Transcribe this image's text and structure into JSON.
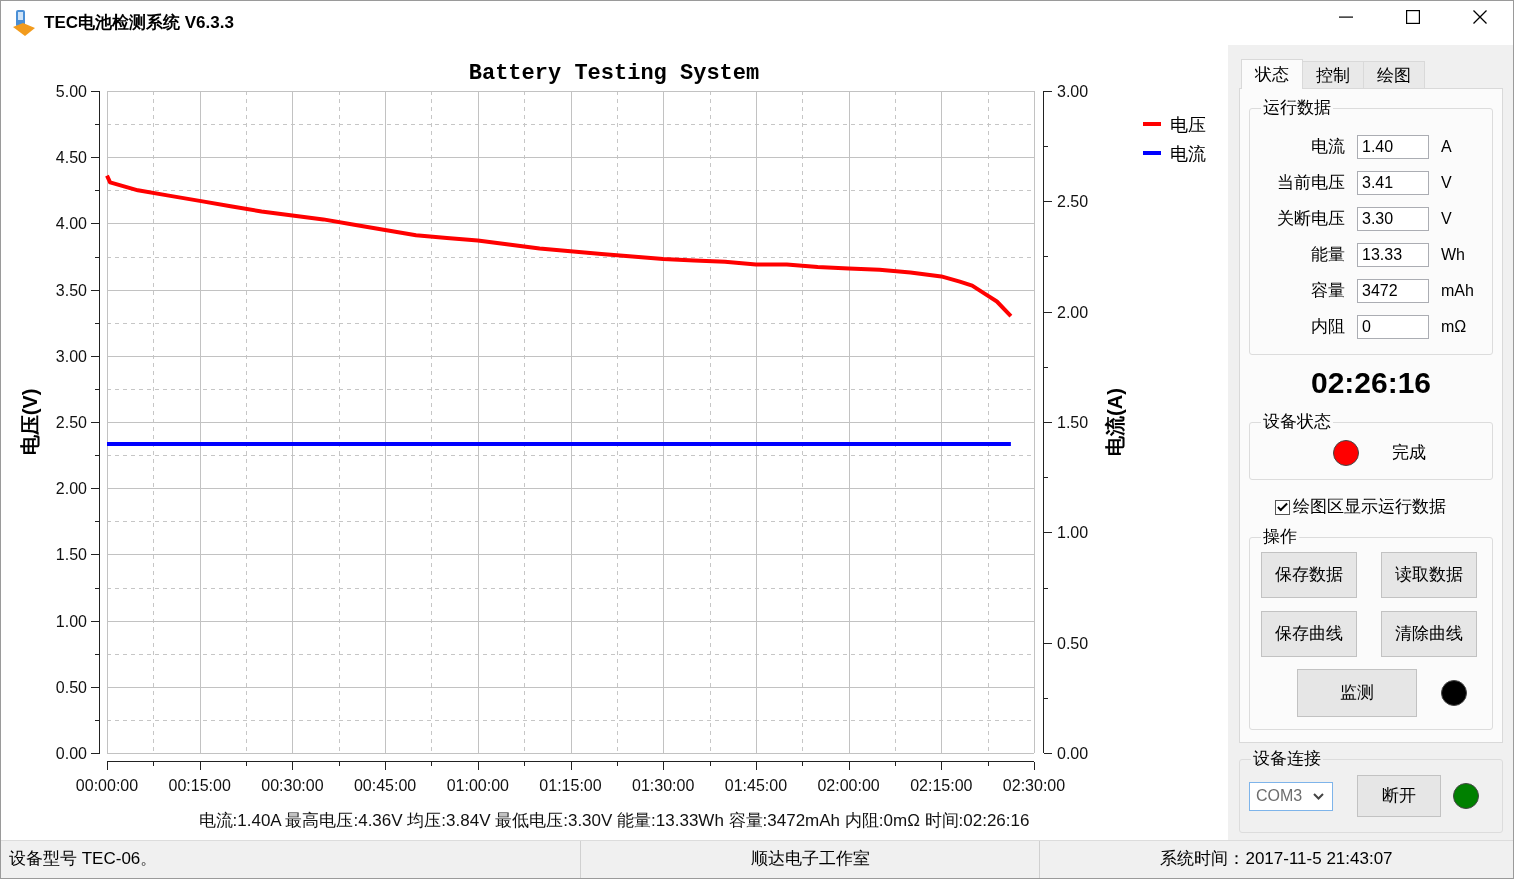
{
  "window": {
    "title": "TEC电池检测系统 V6.3.3"
  },
  "chart": {
    "chart_data": {
      "type": "line",
      "title": "Battery Testing System",
      "ylabel": "电压(V)",
      "y2label": "电流(A)",
      "grid": true,
      "legend": "right",
      "x": [
        0,
        0.5,
        5,
        10,
        15,
        20,
        25,
        30,
        35,
        40,
        45,
        50,
        55,
        60,
        65,
        70,
        75,
        80,
        85,
        90,
        95,
        100,
        105,
        110,
        115,
        120,
        125,
        130,
        135,
        138,
        140,
        142,
        144,
        146.27
      ],
      "xlim": [
        0,
        150
      ],
      "ylim": [
        0,
        5
      ],
      "y2lim": [
        0,
        3
      ],
      "xticks": [
        {
          "value": 0,
          "label": "00:00:00"
        },
        {
          "value": 15,
          "label": "00:15:00"
        },
        {
          "value": 30,
          "label": "00:30:00"
        },
        {
          "value": 45,
          "label": "00:45:00"
        },
        {
          "value": 60,
          "label": "01:00:00"
        },
        {
          "value": 75,
          "label": "01:15:00"
        },
        {
          "value": 90,
          "label": "01:30:00"
        },
        {
          "value": 105,
          "label": "01:45:00"
        },
        {
          "value": 120,
          "label": "02:00:00"
        },
        {
          "value": 135,
          "label": "02:15:00"
        },
        {
          "value": 150,
          "label": "02:30:00"
        }
      ],
      "yticks": [
        {
          "value": 0,
          "label": "0.00"
        },
        {
          "value": 0.5,
          "label": "0.50"
        },
        {
          "value": 1,
          "label": "1.00"
        },
        {
          "value": 1.5,
          "label": "1.50"
        },
        {
          "value": 2,
          "label": "2.00"
        },
        {
          "value": 2.5,
          "label": "2.50"
        },
        {
          "value": 3,
          "label": "3.00"
        },
        {
          "value": 3.5,
          "label": "3.50"
        },
        {
          "value": 4,
          "label": "4.00"
        },
        {
          "value": 4.5,
          "label": "4.50"
        },
        {
          "value": 5,
          "label": "5.00"
        }
      ],
      "y2ticks": [
        {
          "value": 0,
          "label": "0.00"
        },
        {
          "value": 0.5,
          "label": "0.50"
        },
        {
          "value": 1,
          "label": "1.00"
        },
        {
          "value": 1.5,
          "label": "1.50"
        },
        {
          "value": 2,
          "label": "2.00"
        },
        {
          "value": 2.5,
          "label": "2.50"
        },
        {
          "value": 3,
          "label": "3.00"
        }
      ],
      "series": [
        {
          "name": "电压",
          "color": "#ff0000",
          "axis": "y",
          "values": [
            4.36,
            4.31,
            4.25,
            4.21,
            4.17,
            4.13,
            4.09,
            4.06,
            4.03,
            3.99,
            3.95,
            3.91,
            3.89,
            3.87,
            3.84,
            3.81,
            3.79,
            3.77,
            3.75,
            3.73,
            3.72,
            3.71,
            3.69,
            3.69,
            3.67,
            3.66,
            3.65,
            3.63,
            3.6,
            3.56,
            3.53,
            3.47,
            3.41,
            3.3
          ]
        },
        {
          "name": "电流",
          "color": "#0000ff",
          "axis": "y2",
          "values": [
            1.4,
            1.4,
            1.4,
            1.4,
            1.4,
            1.4,
            1.4,
            1.4,
            1.4,
            1.4,
            1.4,
            1.4,
            1.4,
            1.4,
            1.4,
            1.4,
            1.4,
            1.4,
            1.4,
            1.4,
            1.4,
            1.4,
            1.4,
            1.4,
            1.4,
            1.4,
            1.4,
            1.4,
            1.4,
            1.4,
            1.4,
            1.4,
            1.4,
            1.4
          ]
        }
      ]
    },
    "summary": "电流:1.40A 最高电压:4.36V 均压:3.84V 最低电压:3.30V 能量:13.33Wh 容量:3472mAh 内阻:0mΩ 时间:02:26:16"
  },
  "tabs": [
    {
      "label": "状态",
      "selected": true
    },
    {
      "label": "控制",
      "selected": false
    },
    {
      "label": "绘图",
      "selected": false
    }
  ],
  "running_data": {
    "title": "运行数据",
    "fields": [
      {
        "label": "电流",
        "value": "1.40",
        "unit": "A"
      },
      {
        "label": "当前电压",
        "value": "3.41",
        "unit": "V"
      },
      {
        "label": "关断电压",
        "value": "3.30",
        "unit": "V"
      },
      {
        "label": "能量",
        "value": "13.33",
        "unit": "Wh"
      },
      {
        "label": "容量",
        "value": "3472",
        "unit": "mAh"
      },
      {
        "label": "内阻",
        "value": "0",
        "unit": "mΩ"
      }
    ]
  },
  "elapsed_time": "02:26:16",
  "device_status": {
    "title": "设备状态",
    "color": "#ff0000",
    "text": "完成"
  },
  "show_data_checkbox": {
    "label": "绘图区显示运行数据",
    "checked": true
  },
  "operations": {
    "title": "操作",
    "buttons": [
      "保存数据",
      "读取数据",
      "保存曲线",
      "清除曲线"
    ],
    "monitor": {
      "label": "监测",
      "color": "#000000"
    }
  },
  "connection": {
    "title": "设备连接",
    "port": "COM3",
    "button": "断开",
    "color": "#008000"
  },
  "status_bar": [
    "设备型号 TEC-06。",
    "顺达电子工作室",
    "系统时间：2017-11-5 21:43:07"
  ]
}
